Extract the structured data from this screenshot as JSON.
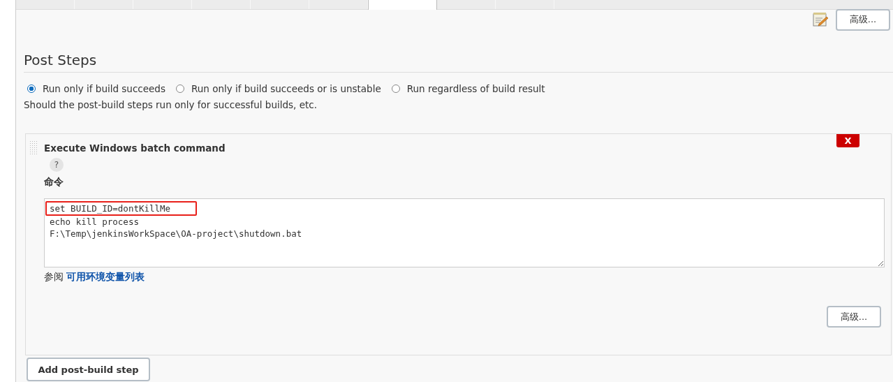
{
  "tabs": [
    {
      "selected": false
    },
    {
      "selected": false
    },
    {
      "selected": false
    },
    {
      "selected": false
    },
    {
      "selected": false
    },
    {
      "selected": false
    },
    {
      "selected": true
    },
    {
      "selected": false
    },
    {
      "selected": false
    }
  ],
  "top_advanced_button": "高级...",
  "section": {
    "title": "Post Steps",
    "options": [
      {
        "label": "Run only if build succeeds",
        "selected": true
      },
      {
        "label": "Run only if build succeeds or is unstable",
        "selected": false
      },
      {
        "label": "Run regardless of build result",
        "selected": false
      }
    ],
    "description": "Should the post-build steps run only for successful builds, etc."
  },
  "step": {
    "title": "Execute Windows batch command",
    "delete_button": "X",
    "help_button": "?",
    "field_label": "命令",
    "command_lines": [
      {
        "text": "set BUILD_ID=dontKillMe",
        "highlighted": true
      },
      {
        "text": "echo kill process",
        "highlighted": false
      },
      {
        "text": "F:\\Temp\\jenkinsWorkSpace\\OA-project\\shutdown.bat",
        "highlighted": false
      }
    ],
    "see_also": "参阅",
    "env_link": "可用环境变量列表",
    "advanced_button": "高级..."
  },
  "add_button": "Add post-build step"
}
